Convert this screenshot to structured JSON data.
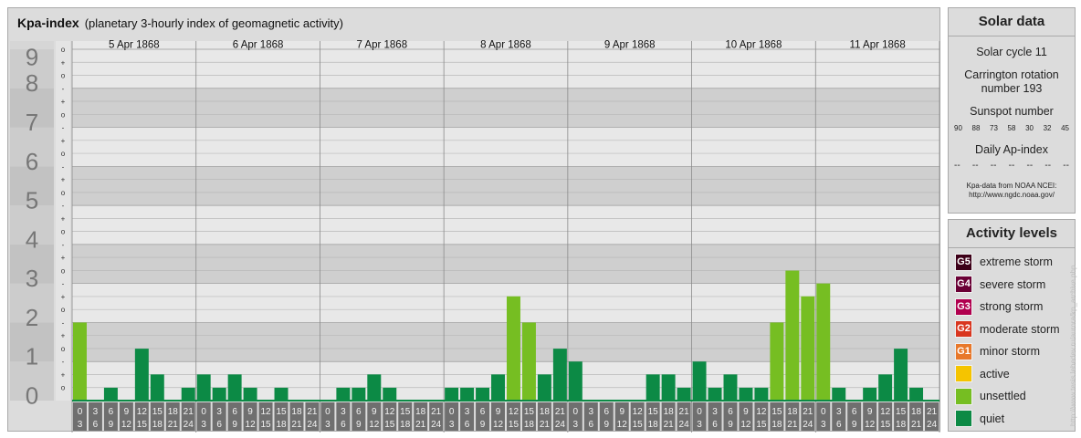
{
  "header": {
    "title": "Kpa-index",
    "subtitle": "(planetary 3-hourly index of geomagnetic activity)"
  },
  "chart_data": {
    "type": "bar",
    "title": "Kpa-index",
    "subtitle": "(planetary 3-hourly index of geomagnetic activity)",
    "ylim": [
      0,
      9
    ],
    "y_ticks": [
      "0",
      "1",
      "2",
      "3",
      "4",
      "5",
      "6",
      "7",
      "8",
      "9"
    ],
    "minor_ticks": [
      "-",
      "o",
      "+"
    ],
    "days": [
      "5 Apr 1868",
      "6 Apr 1868",
      "7 Apr 1868",
      "8 Apr 1868",
      "9 Apr 1868",
      "10 Apr 1868",
      "11 Apr 1868"
    ],
    "interval_start_labels": [
      "0",
      "3",
      "6",
      "9",
      "12",
      "15",
      "18",
      "21"
    ],
    "interval_end_labels": [
      "3",
      "6",
      "9",
      "12",
      "15",
      "18",
      "21",
      "24"
    ],
    "values": [
      2,
      0,
      0.33,
      0,
      1.33,
      0.67,
      0,
      0.33,
      0.67,
      0.33,
      0.67,
      0.33,
      0,
      0.33,
      0,
      0,
      0,
      0.33,
      0.33,
      0.67,
      0.33,
      0,
      0,
      0,
      0.33,
      0.33,
      0.33,
      0.67,
      2.67,
      2,
      0.67,
      1.33,
      1,
      0,
      0,
      0,
      0,
      0.67,
      0.67,
      0.33,
      1,
      0.33,
      0.67,
      0.33,
      0.33,
      2,
      3.33,
      2.67,
      3,
      0.33,
      0,
      0.33,
      0.67,
      1.33,
      0.33,
      0
    ],
    "colors": {
      "quiet": "#0c8a45",
      "unsettled": "#76be22"
    }
  },
  "solar": {
    "title": "Solar data",
    "cycle": "Solar cycle 11",
    "carrington": "Carrington rotation number 193",
    "sunspot_label": "Sunspot number",
    "sunspots": [
      "90",
      "88",
      "73",
      "58",
      "30",
      "32",
      "45"
    ],
    "ap_label": "Daily Ap-index",
    "ap_values": [
      "--",
      "--",
      "--",
      "--",
      "--",
      "--",
      "--"
    ],
    "credit_line1": "Kpa-data from NOAA NCEI:",
    "credit_line2": "http://www.ngdc.noaa.gov/"
  },
  "activity": {
    "title": "Activity levels",
    "levels": [
      {
        "badge": "G5",
        "label": "extreme storm",
        "color": "#3d0018"
      },
      {
        "badge": "G4",
        "label": "severe storm",
        "color": "#6a0035"
      },
      {
        "badge": "G3",
        "label": "strong storm",
        "color": "#b1004f"
      },
      {
        "badge": "G2",
        "label": "moderate storm",
        "color": "#d9361f"
      },
      {
        "badge": "G1",
        "label": "minor storm",
        "color": "#e8782a"
      },
      {
        "badge": "",
        "label": "active",
        "color": "#f5c400"
      },
      {
        "badge": "",
        "label": "unsettled",
        "color": "#76be22"
      },
      {
        "badge": "",
        "label": "quiet",
        "color": "#0c8a45"
      }
    ]
  },
  "footer": {
    "vertical_url": "http://www.tesis.lebedev.ru/aurora/kp_archive.php"
  }
}
